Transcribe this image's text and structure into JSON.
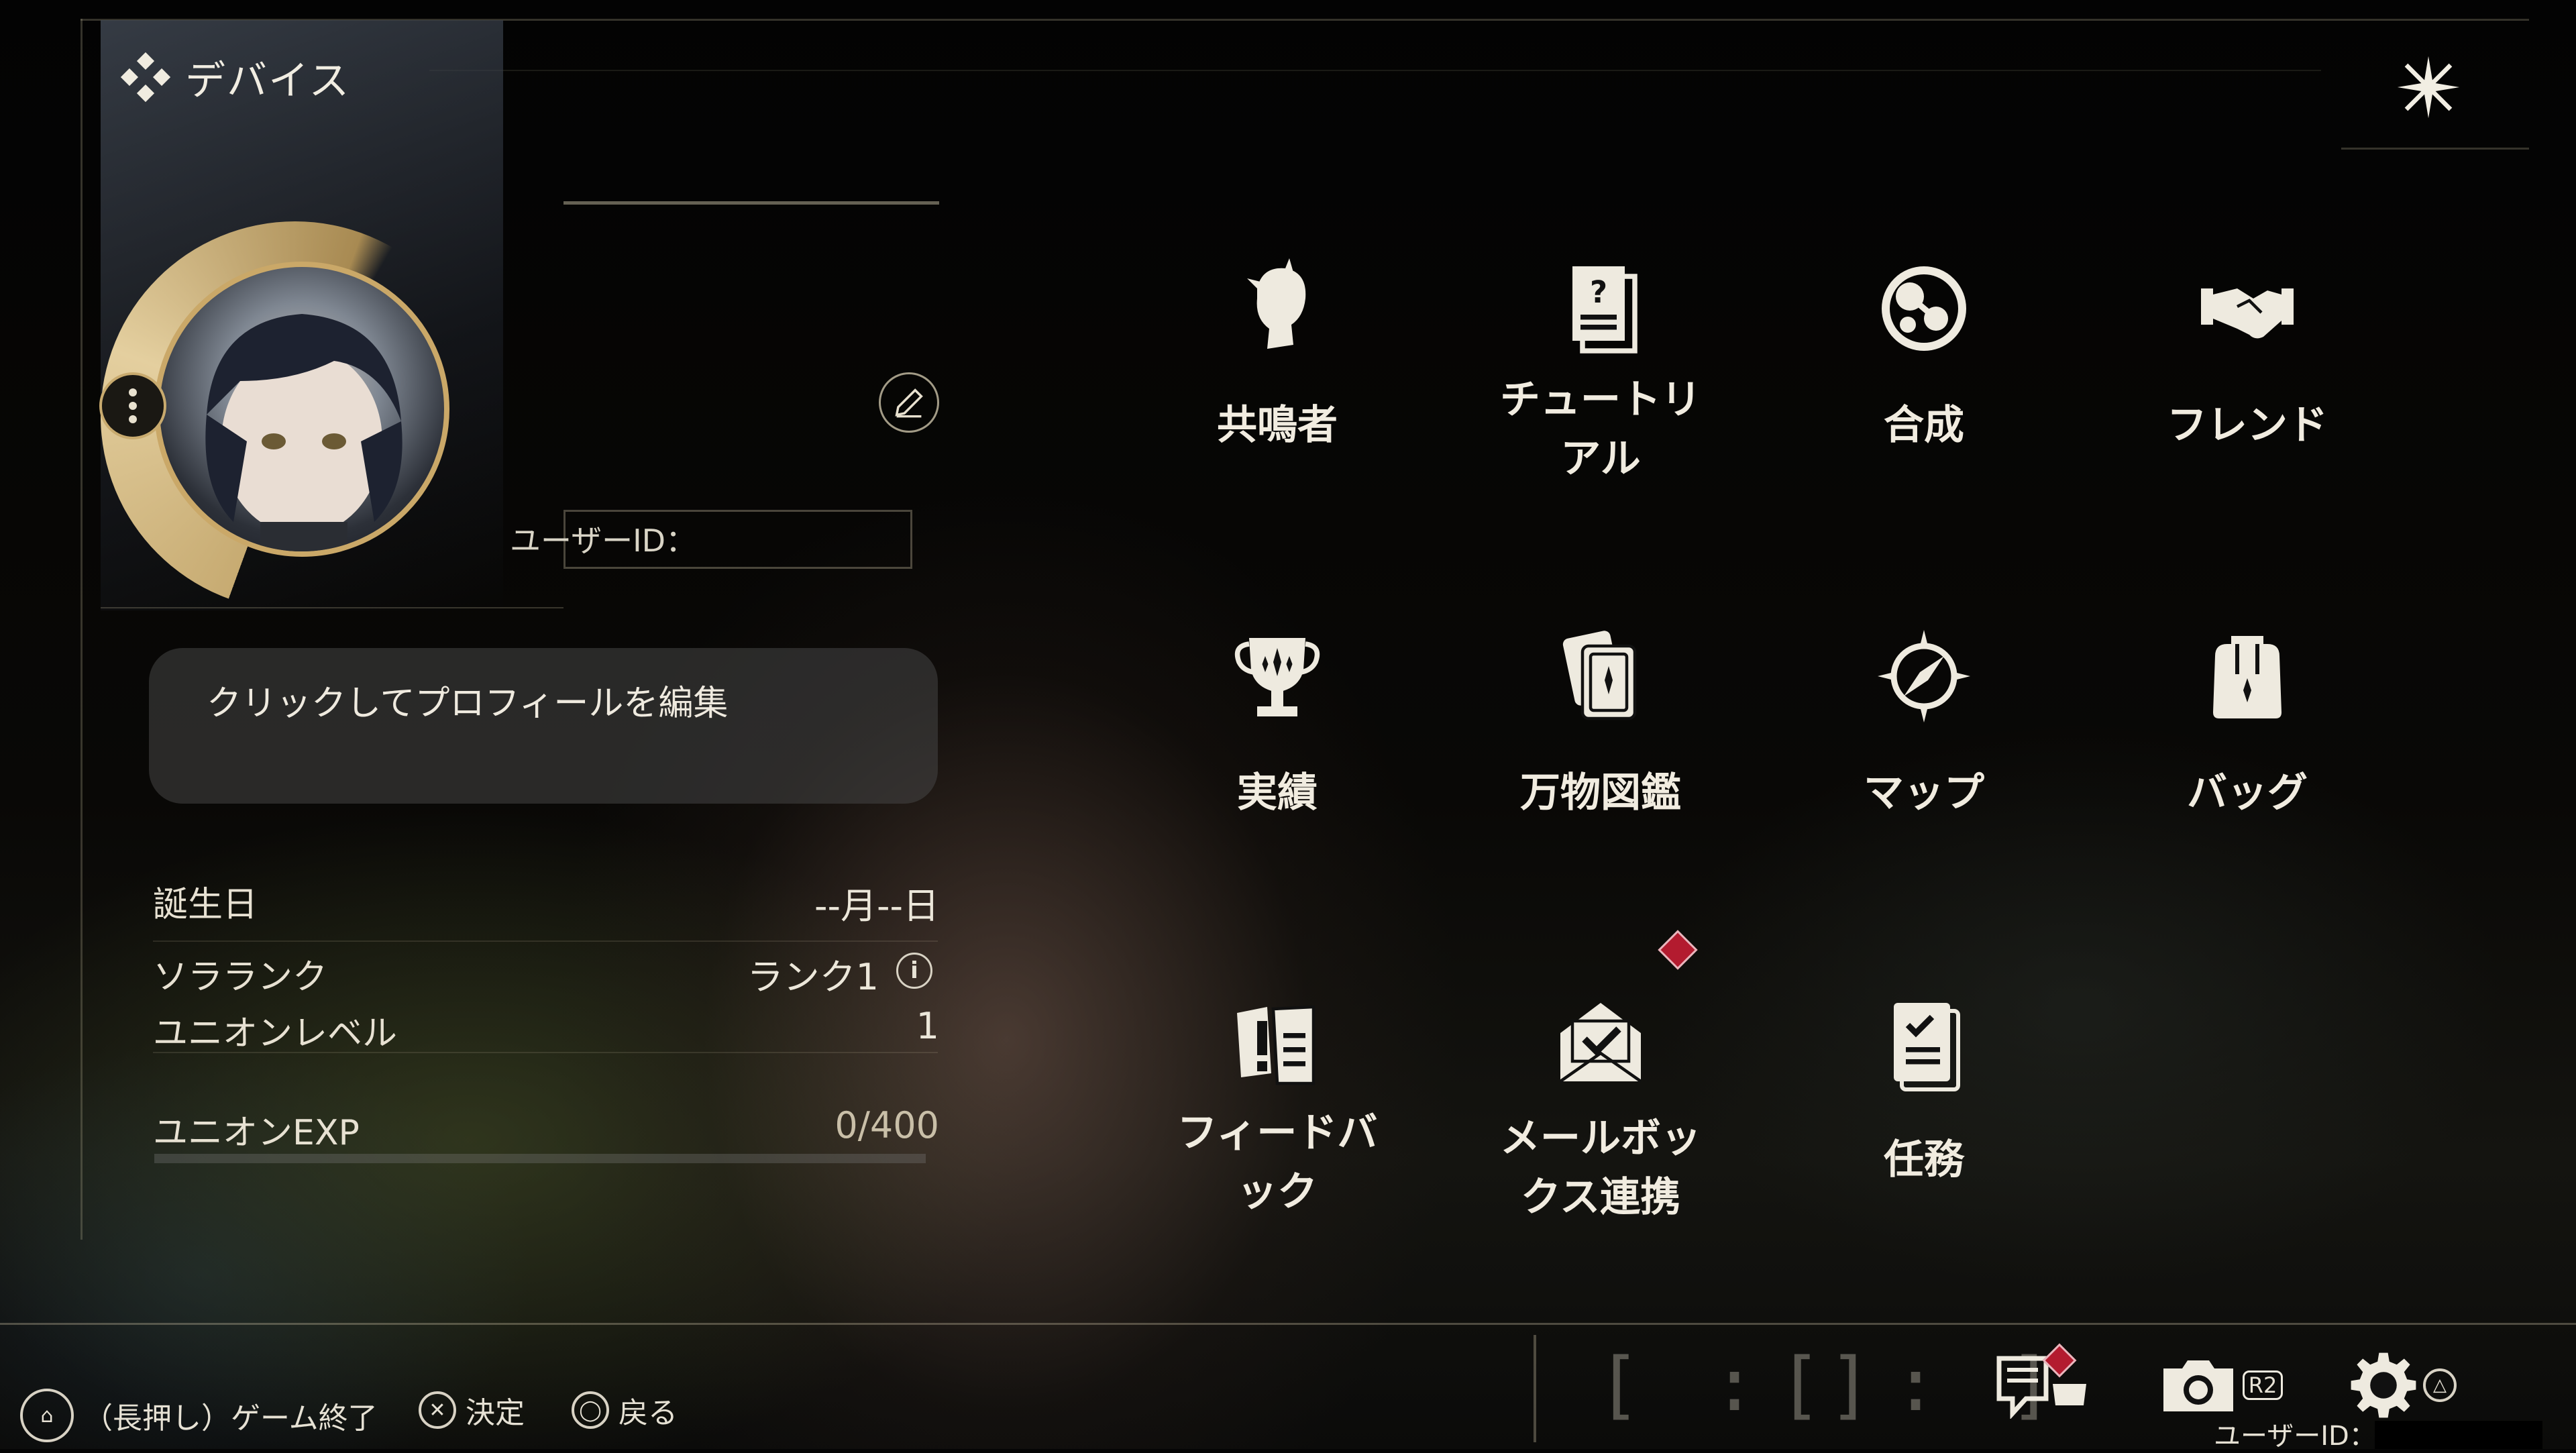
{
  "header": {
    "title": "デバイス"
  },
  "profile": {
    "user_id_label": "ユーザーID：",
    "edit_prompt": "クリックしてプロフィールを編集",
    "stats": [
      {
        "label": "誕生日",
        "value": "--月--日"
      },
      {
        "label": "ソラランク",
        "value": "ランク1"
      },
      {
        "label": "ユニオンレベル",
        "value": "1"
      },
      {
        "label": "ユニオンEXP",
        "value": "0/400"
      }
    ],
    "exp_progress": 0
  },
  "menu": [
    {
      "label": "共鳴者",
      "icon": "resonator-icon"
    },
    {
      "label": "チュートリ\nアル",
      "icon": "tutorial-icon"
    },
    {
      "label": "合成",
      "icon": "synthesis-icon"
    },
    {
      "label": "フレンド",
      "icon": "friends-icon"
    },
    {
      "label": "実績",
      "icon": "trophy-icon"
    },
    {
      "label": "万物図鑑",
      "icon": "databank-icon"
    },
    {
      "label": "マップ",
      "icon": "compass-icon"
    },
    {
      "label": "バッグ",
      "icon": "backpack-icon"
    },
    {
      "label": "フィードバ\nック",
      "icon": "feedback-icon"
    },
    {
      "label": "メールボッ\nクス連携",
      "icon": "mail-icon",
      "badge": true
    },
    {
      "label": "任務",
      "icon": "quest-icon"
    }
  ],
  "footer": {
    "hints": [
      {
        "button": "⌂",
        "label": "（長押し）ゲーム終了"
      },
      {
        "button": "✕",
        "label": "決定"
      },
      {
        "button": "◯",
        "label": "戻る"
      }
    ],
    "brackets": [
      "[ : ]",
      "[ : ]"
    ],
    "button_r2": "R2",
    "button_triangle": "△",
    "user_id_label": "ユーザーID："
  },
  "colors": {
    "accent_gold": "#c8aa6e",
    "badge_red": "#b31b2f",
    "text": "#ece7da"
  }
}
